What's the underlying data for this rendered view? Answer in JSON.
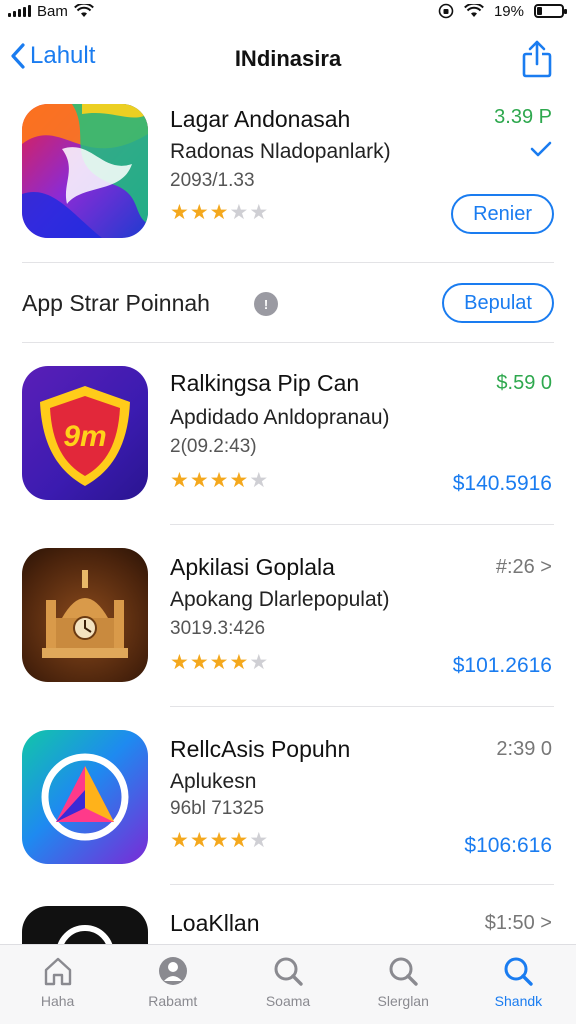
{
  "status_bar": {
    "carrier": "Bam",
    "battery": "19%",
    "battery_level": 0.19
  },
  "nav": {
    "back_label": "Lahult",
    "title": "INdinasira"
  },
  "apps": [
    {
      "name": "Lagar Andonasah",
      "subtitle": "Radonas Nladopanlark)",
      "meta": "2093/1.33",
      "rating": 3,
      "price_top": "3.39 P",
      "action_label": "Renier",
      "price_top_color": "#2ea84e"
    },
    {
      "name": "Ralkingsa Pip Can",
      "subtitle": "Apdidado Anldopranau)",
      "meta": "2(09.2:43)",
      "rating": 4,
      "price_top": "$.59 0",
      "price_bottom": "$140.5916",
      "icon_text": "9m",
      "price_top_color": "#2ea84e"
    },
    {
      "name": "Apkilasi Goplala",
      "subtitle": "Apokang Dlarlepopulat)",
      "meta": "3019.3:426",
      "rating": 4,
      "price_top": "#:26 >",
      "price_bottom": "$101.2616",
      "price_top_color": "#777777"
    },
    {
      "name": "RellcAsis Popuhn",
      "subtitle": "Aplukesn",
      "meta": "96bl 71325",
      "rating": 4,
      "price_top": "2:39 0",
      "price_bottom": "$106:616",
      "price_top_color": "#777777"
    },
    {
      "name": "LoaKllan",
      "price_top": "$1:50 >",
      "price_top_color": "#777777"
    }
  ],
  "section": {
    "title": "App Strar Poinnah",
    "button_label": "Bepulat"
  },
  "tabs": [
    {
      "label": "Haha",
      "icon": "home-icon"
    },
    {
      "label": "Rabamt",
      "icon": "person-icon"
    },
    {
      "label": "Soama",
      "icon": "search-icon"
    },
    {
      "label": "Slerglan",
      "icon": "search-icon"
    },
    {
      "label": "Shandk",
      "icon": "search-icon",
      "active": true
    }
  ],
  "colors": {
    "accent": "#1a7cf0",
    "star": "#f4a81d",
    "price_green": "#2ea84e"
  }
}
